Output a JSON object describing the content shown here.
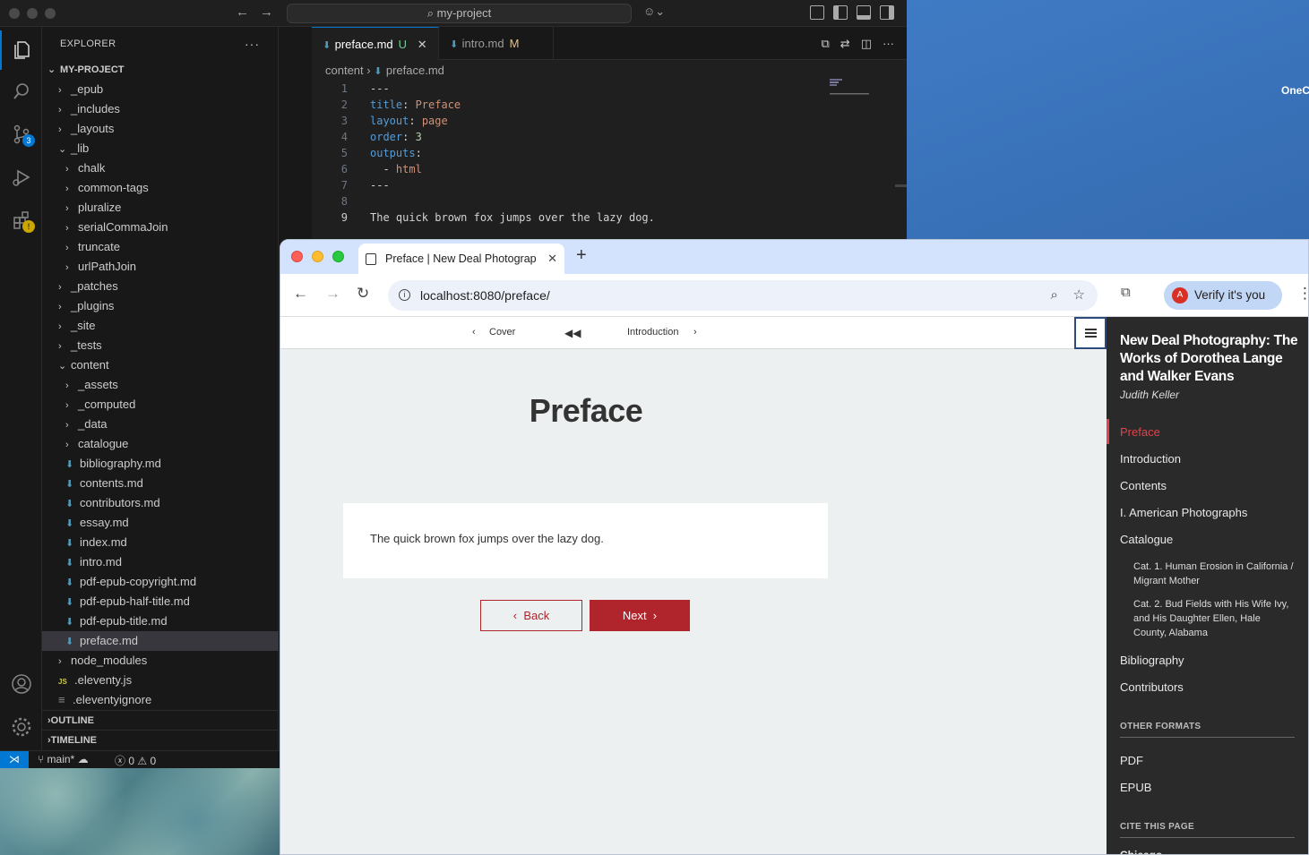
{
  "desktop": {
    "label": "OneC"
  },
  "vscode": {
    "search_text": "my-project",
    "explorer_title": "EXPLORER",
    "project_root": "MY-PROJECT",
    "source_control_badge": "3",
    "tree": [
      {
        "label": "_epub",
        "kind": "folder",
        "open": false,
        "depth": 1
      },
      {
        "label": "_includes",
        "kind": "folder",
        "open": false,
        "depth": 1
      },
      {
        "label": "_layouts",
        "kind": "folder",
        "open": false,
        "depth": 1
      },
      {
        "label": "_lib",
        "kind": "folder",
        "open": true,
        "depth": 1
      },
      {
        "label": "chalk",
        "kind": "folder",
        "open": false,
        "depth": 2
      },
      {
        "label": "common-tags",
        "kind": "folder",
        "open": false,
        "depth": 2
      },
      {
        "label": "pluralize",
        "kind": "folder",
        "open": false,
        "depth": 2
      },
      {
        "label": "serialCommaJoin",
        "kind": "folder",
        "open": false,
        "depth": 2
      },
      {
        "label": "truncate",
        "kind": "folder",
        "open": false,
        "depth": 2
      },
      {
        "label": "urlPathJoin",
        "kind": "folder",
        "open": false,
        "depth": 2
      },
      {
        "label": "_patches",
        "kind": "folder",
        "open": false,
        "depth": 1
      },
      {
        "label": "_plugins",
        "kind": "folder",
        "open": false,
        "depth": 1
      },
      {
        "label": "_site",
        "kind": "folder",
        "open": false,
        "depth": 1
      },
      {
        "label": "_tests",
        "kind": "folder",
        "open": false,
        "depth": 1
      },
      {
        "label": "content",
        "kind": "folder",
        "open": true,
        "depth": 1
      },
      {
        "label": "_assets",
        "kind": "folder",
        "open": false,
        "depth": 2
      },
      {
        "label": "_computed",
        "kind": "folder",
        "open": false,
        "depth": 2
      },
      {
        "label": "_data",
        "kind": "folder",
        "open": false,
        "depth": 2
      },
      {
        "label": "catalogue",
        "kind": "folder",
        "open": false,
        "depth": 2
      },
      {
        "label": "bibliography.md",
        "kind": "md",
        "depth": 2
      },
      {
        "label": "contents.md",
        "kind": "md",
        "depth": 2
      },
      {
        "label": "contributors.md",
        "kind": "md",
        "depth": 2
      },
      {
        "label": "essay.md",
        "kind": "md",
        "depth": 2
      },
      {
        "label": "index.md",
        "kind": "md",
        "depth": 2
      },
      {
        "label": "intro.md",
        "kind": "md",
        "depth": 2
      },
      {
        "label": "pdf-epub-copyright.md",
        "kind": "md",
        "depth": 2
      },
      {
        "label": "pdf-epub-half-title.md",
        "kind": "md",
        "depth": 2
      },
      {
        "label": "pdf-epub-title.md",
        "kind": "md",
        "depth": 2
      },
      {
        "label": "preface.md",
        "kind": "md",
        "depth": 2,
        "selected": true
      },
      {
        "label": "node_modules",
        "kind": "folder",
        "open": false,
        "depth": 1
      },
      {
        "label": ".eleventy.js",
        "kind": "js",
        "depth": 1
      },
      {
        "label": ".eleventyignore",
        "kind": "ignore",
        "depth": 1
      }
    ],
    "sections": [
      "OUTLINE",
      "TIMELINE"
    ],
    "tabs": [
      {
        "label": "preface.md",
        "status": "U",
        "active": true
      },
      {
        "label": "intro.md",
        "status": "M",
        "active": false
      }
    ],
    "breadcrumb": {
      "folder": "content",
      "file": "preface.md"
    },
    "code_lines": [
      [
        {
          "t": "---",
          "c": "p"
        }
      ],
      [
        {
          "t": "title",
          "c": "k"
        },
        {
          "t": ": ",
          "c": "p"
        },
        {
          "t": "Preface",
          "c": "s"
        }
      ],
      [
        {
          "t": "layout",
          "c": "k"
        },
        {
          "t": ": ",
          "c": "p"
        },
        {
          "t": "page",
          "c": "s"
        }
      ],
      [
        {
          "t": "order",
          "c": "k"
        },
        {
          "t": ": ",
          "c": "p"
        },
        {
          "t": "3",
          "c": "n"
        }
      ],
      [
        {
          "t": "outputs",
          "c": "k"
        },
        {
          "t": ":",
          "c": "p"
        }
      ],
      [
        {
          "t": "  - ",
          "c": "p"
        },
        {
          "t": "html",
          "c": "s"
        }
      ],
      [
        {
          "t": "---",
          "c": "p"
        }
      ],
      [],
      [
        {
          "t": "The quick brown fox jumps over the lazy dog.",
          "c": "p"
        }
      ]
    ],
    "current_line": 9,
    "status": {
      "branch": "main*",
      "errors": "0",
      "warnings": "0"
    }
  },
  "browser": {
    "tab_title": "Preface | New Deal Photography: The Works of Dorothea Lange and Walker Evans",
    "url": "localhost:8080/preface/",
    "verify_label": "Verify it's you",
    "avatar_letter": "A",
    "page": {
      "nav_prev": "Cover",
      "nav_next": "Introduction",
      "title": "Preface",
      "body": "The quick brown fox jumps over the lazy dog.",
      "back_label": "Back",
      "next_label": "Next"
    },
    "toc": {
      "book_title": "New Deal Photography: The Works of Dorothea Lange and Walker Evans",
      "author": "Judith Keller",
      "items": [
        "Preface",
        "Introduction",
        "Contents",
        "I. American Photographs",
        "Catalogue"
      ],
      "sub_items": [
        "Cat. 1. Human Erosion in California / Migrant Mother",
        "Cat. 2. Bud Fields with His Wife Ivy, and His Daughter Ellen, Hale County, Alabama"
      ],
      "items_after": [
        "Bibliography",
        "Contributors"
      ],
      "other_formats_heading": "OTHER FORMATS",
      "formats": [
        "PDF",
        "EPUB"
      ],
      "cite_heading": "CITE THIS PAGE",
      "cite_style": "Chicago"
    }
  },
  "colors": {
    "accent_red": "#b0242c",
    "vscode_blue": "#0078d4"
  }
}
